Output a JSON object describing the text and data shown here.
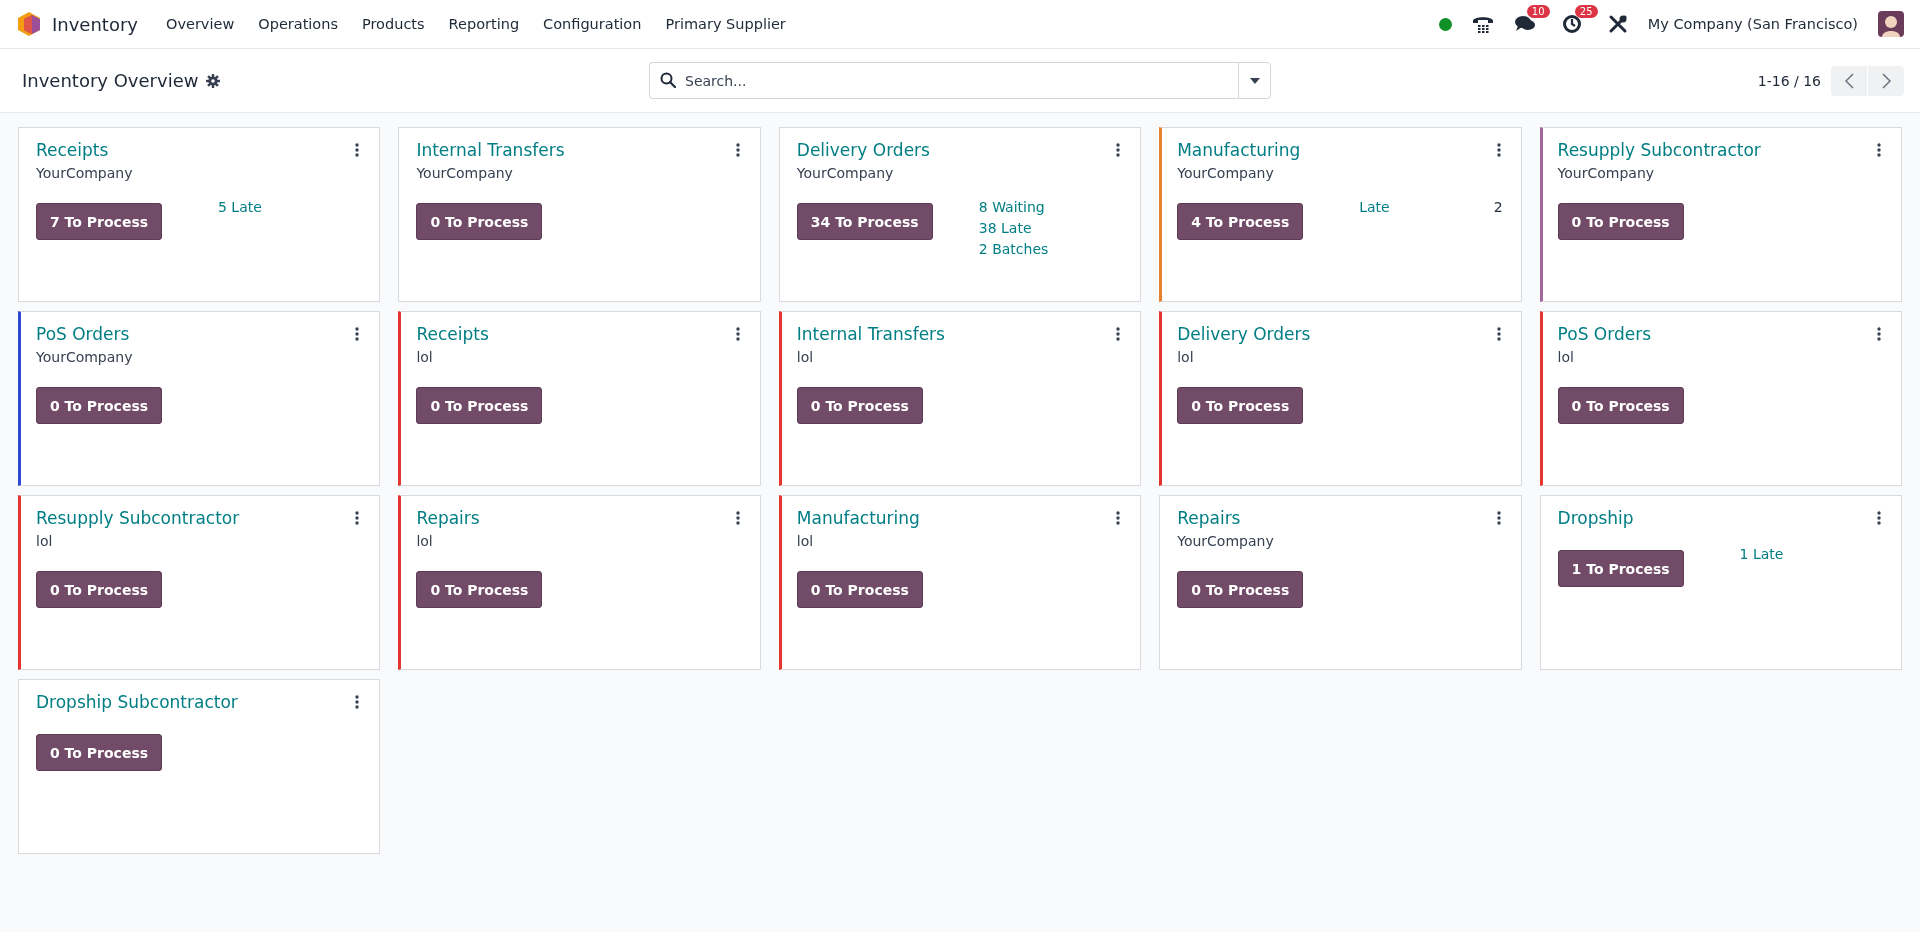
{
  "navbar": {
    "app_name": "Inventory",
    "menu": [
      "Overview",
      "Operations",
      "Products",
      "Reporting",
      "Configuration",
      "Primary Supplier"
    ],
    "status_online": true,
    "messages_count": "10",
    "activities_count": "25",
    "company": "My Company (San Francisco)"
  },
  "control_panel": {
    "title": "Inventory Overview",
    "search": {
      "placeholder": "Search..."
    },
    "pager": "1-16 / 16"
  },
  "cards": [
    {
      "title": "Receipts",
      "subtitle": "YourCompany",
      "action": "7 To Process",
      "stats": [
        {
          "label": "5 Late"
        }
      ]
    },
    {
      "title": "Internal Transfers",
      "subtitle": "YourCompany",
      "action": "0 To Process"
    },
    {
      "title": "Delivery Orders",
      "subtitle": "YourCompany",
      "action": "34 To Process",
      "stats": [
        {
          "label": "8 Waiting"
        },
        {
          "label": "38 Late"
        },
        {
          "label": "2 Batches"
        }
      ]
    },
    {
      "title": "Manufacturing",
      "subtitle": "YourCompany",
      "action": "4 To Process",
      "color": "#e8822f",
      "stats": [
        {
          "label": "Late",
          "value": "2"
        }
      ]
    },
    {
      "title": "Resupply Subcontractor",
      "subtitle": "YourCompany",
      "action": "0 To Process",
      "color": "#a3679f"
    },
    {
      "title": "PoS Orders",
      "subtitle": "YourCompany",
      "action": "0 To Process",
      "color": "#2d49d6"
    },
    {
      "title": "Receipts",
      "subtitle": "lol",
      "action": "0 To Process",
      "color": "#e3342f"
    },
    {
      "title": "Internal Transfers",
      "subtitle": "lol",
      "action": "0 To Process",
      "color": "#e3342f"
    },
    {
      "title": "Delivery Orders",
      "subtitle": "lol",
      "action": "0 To Process",
      "color": "#e3342f"
    },
    {
      "title": "PoS Orders",
      "subtitle": "lol",
      "action": "0 To Process",
      "color": "#e3342f"
    },
    {
      "title": "Resupply Subcontractor",
      "subtitle": "lol",
      "action": "0 To Process",
      "color": "#e3342f"
    },
    {
      "title": "Repairs",
      "subtitle": "lol",
      "action": "0 To Process",
      "color": "#e3342f"
    },
    {
      "title": "Manufacturing",
      "subtitle": "lol",
      "action": "0 To Process",
      "color": "#e3342f"
    },
    {
      "title": "Repairs",
      "subtitle": "YourCompany",
      "action": "0 To Process"
    },
    {
      "title": "Dropship",
      "action": "1 To Process",
      "stats": [
        {
          "label": "1 Late"
        }
      ]
    },
    {
      "title": "Dropship Subcontractor",
      "action": "0 To Process"
    }
  ]
}
